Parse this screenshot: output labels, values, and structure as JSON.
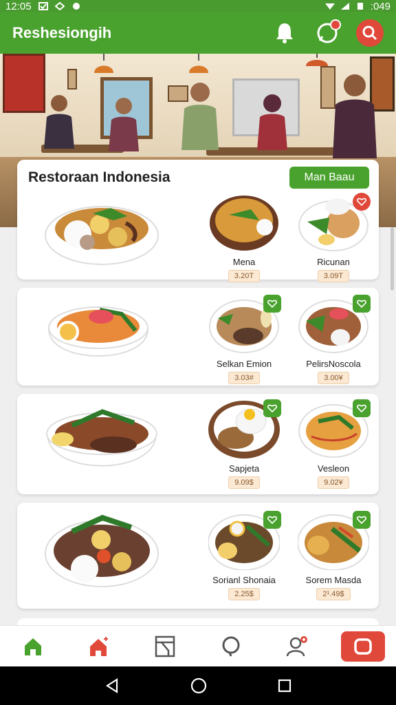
{
  "status_bar": {
    "time": "12:05",
    "battery": ":049"
  },
  "app_bar": {
    "title": "Reshesiongih",
    "bell_icon": "bell-icon",
    "chat_icon": "chat-icon",
    "search_icon": "search-icon"
  },
  "colors": {
    "primary": "#4aa22e",
    "accent": "#e0483a",
    "price_bg": "#fbe9d4"
  },
  "cards": [
    {
      "title": "Restoraan Indonesia",
      "button_label": "Man Baau",
      "dishes": [
        {
          "name": "Mena",
          "price": "3.20T"
        },
        {
          "name": "Ricunan",
          "price": "3.09T"
        }
      ]
    },
    {
      "dishes": [
        {
          "name": "Selkan Emion",
          "price": "3.03#"
        },
        {
          "name": "PelirsNoscola",
          "price": "3.00¥"
        }
      ]
    },
    {
      "dishes": [
        {
          "name": "Sapjeta",
          "price": "9.09$"
        },
        {
          "name": "Vesleon",
          "price": "9.02¥"
        }
      ]
    },
    {
      "dishes": [
        {
          "name": "Sorianl Shonaia",
          "price": "2.25$"
        },
        {
          "name": "Sorem Masda",
          "price": "2¹.49$"
        }
      ]
    }
  ],
  "bottom_nav": [
    "home-icon",
    "restaurant-icon",
    "menu-board-icon",
    "comment-icon",
    "profile-icon",
    "cart-icon"
  ]
}
